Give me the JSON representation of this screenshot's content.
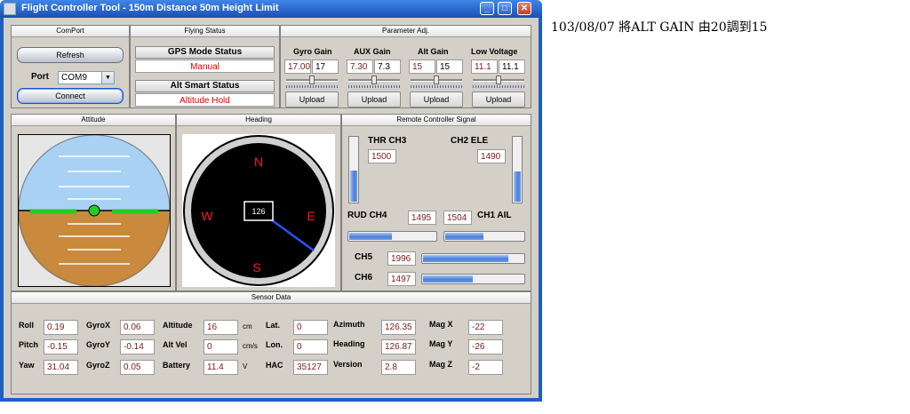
{
  "window": {
    "title": "Flight Controller Tool - 150m Distance 50m Height Limit",
    "minimize": "_",
    "maximize": "□",
    "close": "✕"
  },
  "comport": {
    "title": "ComPort",
    "refresh": "Refresh",
    "port_label": "Port",
    "port_value": "COM9",
    "connect": "Connect"
  },
  "flying_status": {
    "title": "Flying Status",
    "gps_label": "GPS Mode Status",
    "gps_value": "Manual",
    "alt_label": "Alt Smart Status",
    "alt_value": "Altitude Hold"
  },
  "params": {
    "title": "Parameter Adj.",
    "items": [
      {
        "label": "Gyro Gain",
        "current": "17.00",
        "input": "17",
        "upload": "Upload",
        "slider": 0.5
      },
      {
        "label": "AUX Gain",
        "current": "7.30",
        "input": "7.3",
        "upload": "Upload",
        "slider": 0.5
      },
      {
        "label": "Alt Gain",
        "current": "15",
        "input": "15",
        "upload": "Upload",
        "slider": 0.5
      },
      {
        "label": "Low Voltage",
        "current": "11.1",
        "input": "11.1",
        "upload": "Upload",
        "slider": 0.5
      }
    ]
  },
  "attitude": {
    "title": "Attitude"
  },
  "heading": {
    "title": "Heading",
    "n": "N",
    "s": "S",
    "e": "E",
    "w": "W",
    "value": "126"
  },
  "rc": {
    "title": "Remote Controller Signal",
    "thr_label": "THR CH3",
    "thr_value": "1500",
    "thr_level": 0.5,
    "ele_label": "CH2 ELE",
    "ele_value": "1490",
    "ele_level": 0.48,
    "rud_label": "RUD CH4",
    "rud_value": "1495",
    "rud_level": 0.5,
    "ail_label": "CH1 AIL",
    "ail_value": "1504",
    "ail_level": 0.5,
    "ch5_label": "CH5",
    "ch5_value": "1996",
    "ch5_level": 0.85,
    "ch6_label": "CH6",
    "ch6_value": "1497",
    "ch6_level": 0.5
  },
  "sensor": {
    "title": "Sensor Data",
    "roll_label": "Roll",
    "roll": "0.19",
    "pitch_label": "Pitch",
    "pitch": "-0.15",
    "yaw_label": "Yaw",
    "yaw": "31.04",
    "gyrox_label": "GyroX",
    "gyrox": "0.06",
    "gyroy_label": "GyroY",
    "gyroy": "-0.14",
    "gyroz_label": "GyroZ",
    "gyroz": "0.05",
    "altitude_label": "Altitude",
    "altitude": "16",
    "altitude_unit": "cm",
    "altvel_label": "Alt Vel",
    "altvel": "0",
    "altvel_unit": "cm/s",
    "battery_label": "Battery",
    "battery": "11.4",
    "battery_unit": "V",
    "lat_label": "Lat.",
    "lat": "0",
    "lon_label": "Lon.",
    "lon": "0",
    "hac_label": "HAC",
    "hac": "35127",
    "azimuth_label": "Azimuth",
    "azimuth": "126.35",
    "headingv_label": "Heading",
    "headingv": "126.87",
    "version_label": "Version",
    "version": "2.8",
    "magx_label": "Mag X",
    "magx": "-22",
    "magy_label": "Mag Y",
    "magy": "-26",
    "magz_label": "Mag Z",
    "magz": "-2"
  },
  "note": {
    "text": "103/08/07 將ALT GAIN 由20調到15"
  }
}
